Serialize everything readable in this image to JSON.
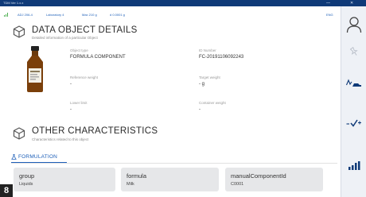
{
  "titlebar": {
    "app_name": "TDM Ver 1.x.x",
    "minimize": "—",
    "close": "✕"
  },
  "status": {
    "items": [
      "ADJ 206-4",
      "Laboratory 4",
      "Max 210 g",
      "d 0.0001 g"
    ],
    "language": "ENG"
  },
  "details": {
    "title": "DATA OBJECT DETAILS",
    "subtitle": "Detailed information of a particular Object",
    "fields": [
      {
        "label": "Object type",
        "value": "FORMULA COMPONENT"
      },
      {
        "label": "ID Number",
        "value": "FC-20191106092243"
      },
      {
        "label": "Reference weight",
        "value": "-"
      },
      {
        "label": "Target weight",
        "value": "- g"
      },
      {
        "label": "Lower limit",
        "value": "-"
      },
      {
        "label": "Container weight",
        "value": "-"
      }
    ]
  },
  "characteristics": {
    "title": "OTHER CHARACTERISTICS",
    "subtitle": "Characteristics related to this object",
    "tab_label": "FORMULATION",
    "cards": [
      {
        "label": "group",
        "value": "Liquids"
      },
      {
        "label": "formula",
        "value": "Milk"
      },
      {
        "label": "manualComponentId",
        "value": "C0001"
      }
    ]
  },
  "badge": "8",
  "colors": {
    "accent": "#1d5fb8",
    "titlebar": "#0f3a78",
    "card": "#e6e7e9"
  },
  "sidebar_icons": [
    "user-icon",
    "pin-icon",
    "weighing-mode-icon",
    "check-plus-icon",
    "bar-chart-icon"
  ]
}
